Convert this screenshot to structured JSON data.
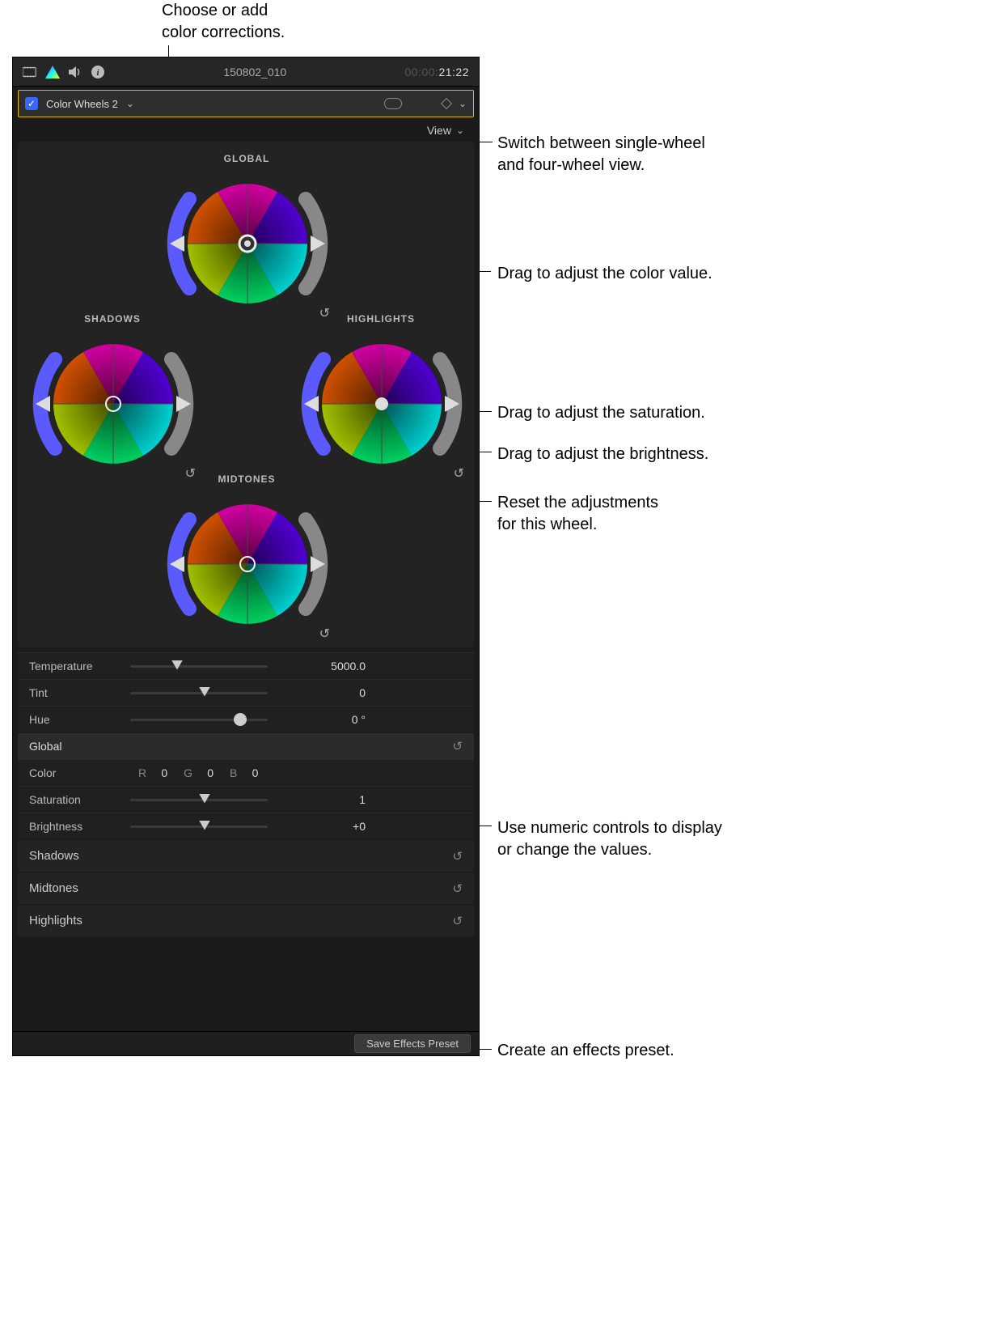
{
  "annotations": {
    "top": "Choose or add\ncolor corrections.",
    "view": "Switch between single-wheel\nand four-wheel view.",
    "center": "Drag to adjust the color value.",
    "sat": "Drag to adjust the saturation.",
    "bri": "Drag to adjust the brightness.",
    "reset": "Reset the adjustments\nfor this wheel.",
    "numeric": "Use numeric controls to display\nor change the values.",
    "preset": "Create an effects preset."
  },
  "header": {
    "clip_name": "150802_010",
    "timecode_dim": "00:00:",
    "timecode_bright": "21:22"
  },
  "effect": {
    "name": "Color Wheels 2",
    "checked": true
  },
  "view_label": "View",
  "wheels": {
    "global": "GLOBAL",
    "shadows": "SHADOWS",
    "highlights": "HIGHLIGHTS",
    "midtones": "MIDTONES"
  },
  "params": {
    "temperature": {
      "label": "Temperature",
      "value": "5000.0",
      "pos": 30
    },
    "tint": {
      "label": "Tint",
      "value": "0",
      "pos": 50
    },
    "hue": {
      "label": "Hue",
      "value": "0 °",
      "pos": 75
    }
  },
  "global_section": {
    "title": "Global",
    "color_label": "Color",
    "r_label": "R",
    "r_value": "0",
    "g_label": "G",
    "g_value": "0",
    "b_label": "B",
    "b_value": "0",
    "saturation": {
      "label": "Saturation",
      "value": "1",
      "pos": 50
    },
    "brightness": {
      "label": "Brightness",
      "value": "+0",
      "pos": 50
    }
  },
  "sections": {
    "shadows": "Shadows",
    "midtones": "Midtones",
    "highlights": "Highlights"
  },
  "footer": {
    "preset_button": "Save Effects Preset"
  }
}
